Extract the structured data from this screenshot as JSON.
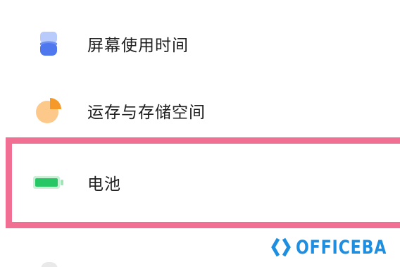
{
  "settings": {
    "items": [
      {
        "id": "screen-time",
        "label": "屏幕使用时间",
        "icon": "hourglass-icon"
      },
      {
        "id": "storage",
        "label": "运存与存储空间",
        "icon": "pie-chart-icon"
      },
      {
        "id": "battery",
        "label": "电池",
        "icon": "battery-icon"
      }
    ]
  },
  "highlight": {
    "target": "battery",
    "color": "#f06f93"
  },
  "watermark": {
    "text": "OFFICEBA",
    "color": "#1e8fe0"
  },
  "colors": {
    "screen_time_icon": "#5b84f0",
    "storage_icon": "#f7a340",
    "battery_icon": "#2fce6a"
  }
}
